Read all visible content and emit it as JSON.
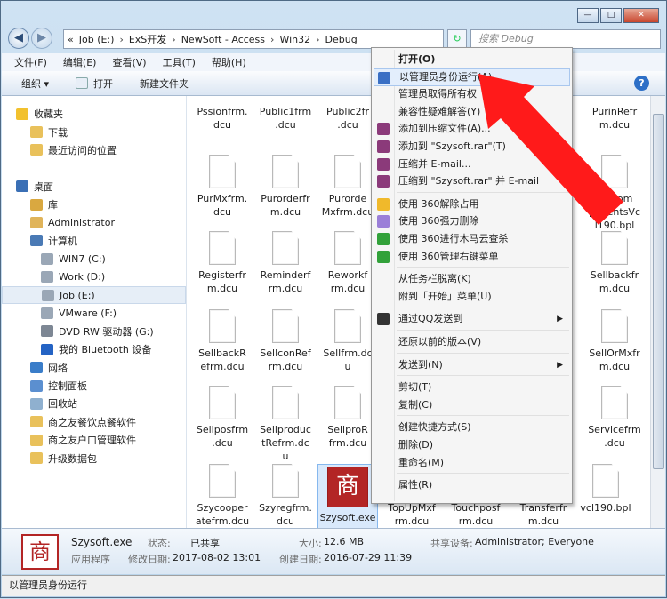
{
  "address": {
    "crumbs": [
      "«",
      "Job (E:)",
      "ExS开发",
      "NewSoft - Access",
      "Win32",
      "Debug"
    ],
    "search_placeholder": "搜索 Debug"
  },
  "menubar": [
    "文件(F)",
    "编辑(E)",
    "查看(V)",
    "工具(T)",
    "帮助(H)"
  ],
  "toolbar": {
    "organize": "组织 ▾",
    "open": "打开",
    "new_folder": "新建文件夹"
  },
  "nav": [
    {
      "label": "收藏夹",
      "icon": "star-icon"
    },
    {
      "label": "下载",
      "icon": "folder-icon"
    },
    {
      "label": "最近访问的位置",
      "icon": "folder-icon"
    },
    {
      "label": "",
      "icon": ""
    },
    {
      "label": "桌面",
      "icon": "desktop-icon"
    },
    {
      "label": "库",
      "icon": "library-icon"
    },
    {
      "label": "Administrator",
      "icon": "user-folder-icon"
    },
    {
      "label": "计算机",
      "icon": "computer-icon"
    },
    {
      "label": "WIN7 (C:)",
      "icon": "drive-icon"
    },
    {
      "label": "Work (D:)",
      "icon": "drive-icon"
    },
    {
      "label": "Job (E:)",
      "icon": "drive-icon"
    },
    {
      "label": "VMware (F:)",
      "icon": "drive-icon"
    },
    {
      "label": "DVD RW 驱动器 (G:)",
      "icon": "dvd-icon"
    },
    {
      "label": "我的 Bluetooth 设备",
      "icon": "bluetooth-icon"
    },
    {
      "label": "网络",
      "icon": "network-icon"
    },
    {
      "label": "控制面板",
      "icon": "control-panel-icon"
    },
    {
      "label": "回收站",
      "icon": "recycle-bin-icon"
    },
    {
      "label": "商之友餐饮点餐软件",
      "icon": "folder-icon"
    },
    {
      "label": "商之友户口管理软件",
      "icon": "folder-icon"
    },
    {
      "label": "升级数据包",
      "icon": "folder-icon"
    }
  ],
  "files": [
    [
      "Pssionfrm.\ndcu",
      "Public1frm\n.dcu",
      "Public2fr\n.dcu",
      "",
      "",
      "PurinRefr\nm.dcu"
    ],
    [
      "PurMxfrm.\ndcu",
      "Purorderfr\nm.dcu",
      "Purorde\nMxfrm.dcu",
      "",
      "",
      "izeCom\nponentsVc\nl190.bpl"
    ],
    [
      "Registerfr\nm.dcu",
      "Reminderf\nrm.dcu",
      "Reworkf\nrm.dcu",
      "",
      "",
      "Sellbackfr\nm.dcu"
    ],
    [
      "SellbackR\nefrm.dcu",
      "SellconRef\nrm.dcu",
      "Sellfrm.dc\nu",
      "",
      "",
      "SellOrMxfr\nm.dcu"
    ],
    [
      "Sellposfrm\n.dcu",
      "Sellproduc\ntRefrm.dc\nu",
      "SellproR\nfrm.dcu",
      "",
      "",
      "Servicefrm\n.dcu"
    ],
    [
      "Szycooper\natefrm.dcu",
      "Szyregfrm.\ndcu",
      "Szysoft.exe\ne",
      "TopUpMxf\nrm.dcu",
      "Touchposf\nrm.dcu",
      "Transferfr\nm.dcu",
      "vcl190.bpl"
    ]
  ],
  "selected_file": "Szysoft.exe",
  "details": {
    "name": "Szysoft.exe",
    "type": "应用程序",
    "state_label": "状态:",
    "state": "已共享",
    "modified_label": "修改日期:",
    "modified": "2017-08-02 13:01",
    "size_label": "大小:",
    "size": "12.6 MB",
    "created_label": "创建日期:",
    "created": "2016-07-29 11:39",
    "share_label": "共享设备:",
    "share": "Administrator; Everyone"
  },
  "status_text": "以管理员身份运行",
  "context_menu": [
    {
      "label": "打开(O)",
      "bold": true
    },
    {
      "label": "以管理员身份运行(A)",
      "icon": "shield-icon",
      "highlight": true
    },
    {
      "label": "管理员取得所有权"
    },
    {
      "label": "兼容性疑难解答(Y)"
    },
    {
      "label": "添加到压缩文件(A)...",
      "icon": "winrar-icon"
    },
    {
      "label": "添加到 \"Szysoft.rar\"(T)",
      "icon": "winrar-icon"
    },
    {
      "label": "压缩并 E-mail...",
      "icon": "winrar-icon"
    },
    {
      "label": "压缩到 \"Szysoft.rar\" 并 E-mail",
      "icon": "winrar-icon"
    },
    {
      "sep": true
    },
    {
      "label": "使用 360解除占用",
      "icon": "360-icon"
    },
    {
      "label": "使用 360强力删除",
      "icon": "360-delete-icon"
    },
    {
      "label": "使用 360进行木马云查杀",
      "icon": "360-scan-icon"
    },
    {
      "label": "使用 360管理右键菜单",
      "icon": "360-scan-icon"
    },
    {
      "sep": true
    },
    {
      "label": "从任务栏脱离(K)"
    },
    {
      "label": "附到「开始」菜单(U)"
    },
    {
      "sep": true
    },
    {
      "label": "通过QQ发送到",
      "icon": "qq-icon",
      "sub": true
    },
    {
      "sep": true
    },
    {
      "label": "还原以前的版本(V)"
    },
    {
      "sep": true
    },
    {
      "label": "发送到(N)",
      "sub": true
    },
    {
      "sep": true
    },
    {
      "label": "剪切(T)"
    },
    {
      "label": "复制(C)"
    },
    {
      "sep": true
    },
    {
      "label": "创建快捷方式(S)"
    },
    {
      "label": "删除(D)"
    },
    {
      "label": "重命名(M)"
    },
    {
      "sep": true
    },
    {
      "label": "属性(R)"
    }
  ],
  "colors": {
    "arrow": "#ff1a1a",
    "accent": "#3b73b9"
  }
}
